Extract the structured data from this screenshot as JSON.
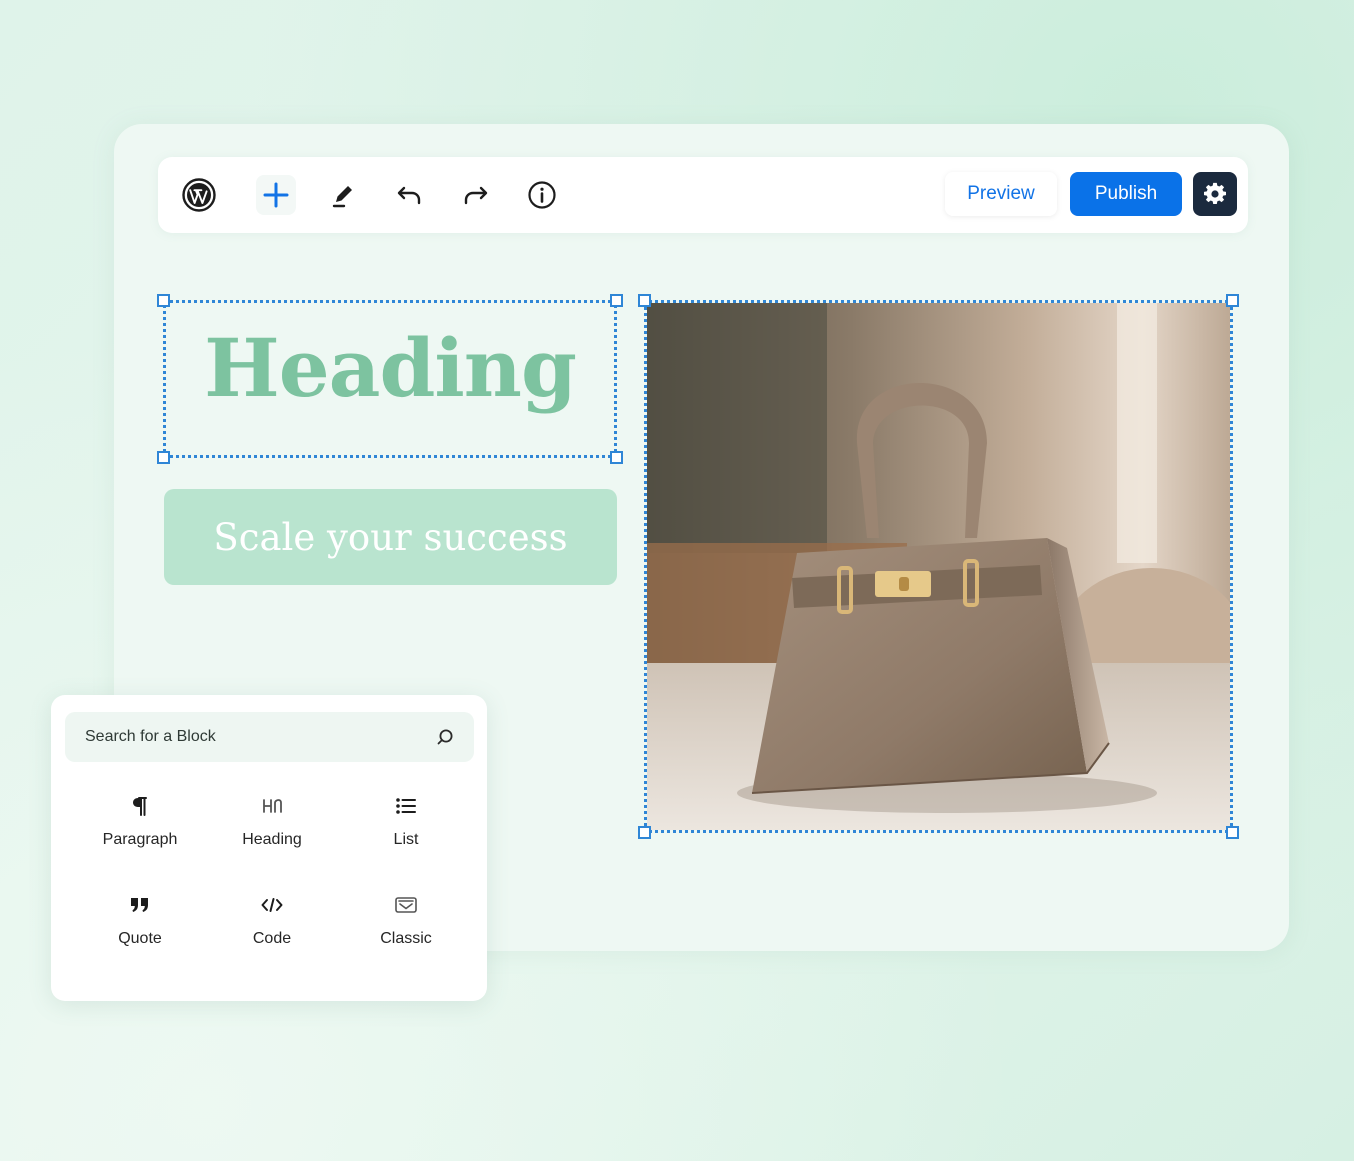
{
  "toolbar": {
    "logo_icon": "wordpress-logo-icon",
    "add_icon": "plus-icon",
    "edit_icon": "pencil-icon",
    "undo_icon": "undo-icon",
    "redo_icon": "redo-icon",
    "info_icon": "info-icon",
    "preview_label": "Preview",
    "publish_label": "Publish",
    "settings_icon": "gear-icon"
  },
  "canvas": {
    "heading_text": "Heading",
    "cta_label": "Scale your success",
    "image_subject": "taupe leather handbag"
  },
  "inserter": {
    "search_placeholder": "Search for a Block",
    "blocks": [
      {
        "label": "Paragraph",
        "icon": "paragraph-icon"
      },
      {
        "label": "Heading",
        "icon": "heading-icon"
      },
      {
        "label": "List",
        "icon": "list-icon"
      },
      {
        "label": "Quote",
        "icon": "quote-icon"
      },
      {
        "label": "Code",
        "icon": "code-icon"
      },
      {
        "label": "Classic",
        "icon": "classic-icon"
      }
    ]
  },
  "colors": {
    "accent": "#0a72e8",
    "selection": "#2f86d6",
    "heading": "#7dc3a0",
    "cta_bg": "#b9e4cf",
    "settings_bg": "#1b2a3e"
  }
}
